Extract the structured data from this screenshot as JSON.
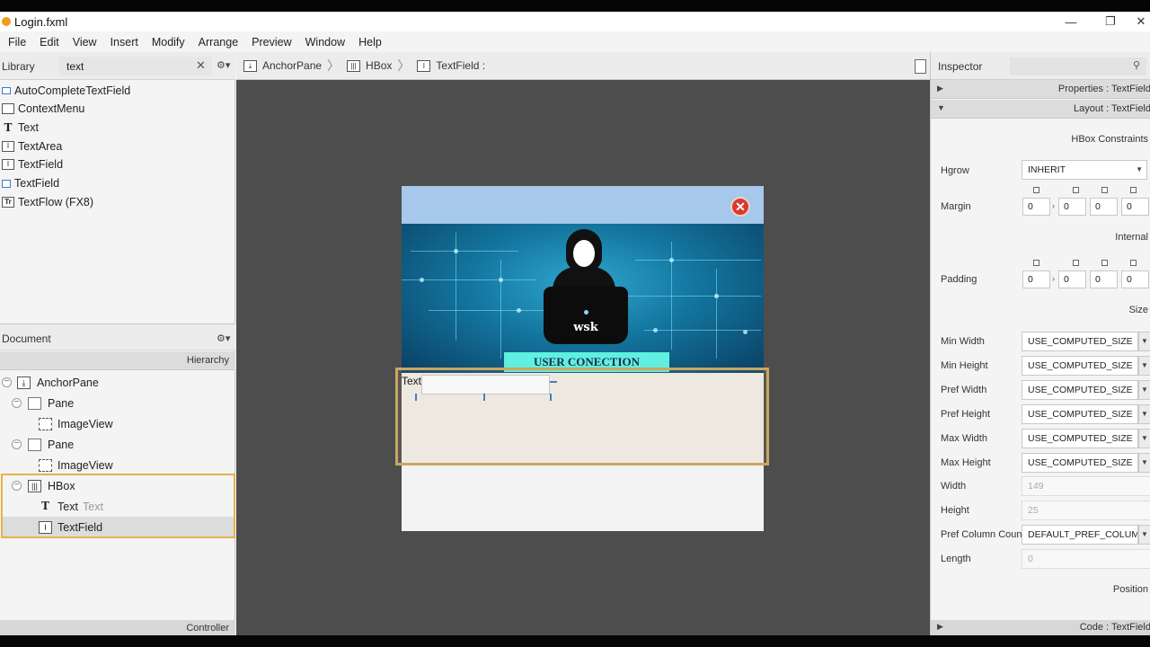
{
  "window": {
    "title": "Login.fxml",
    "minimize": "—",
    "restore": "❐",
    "close": "✕"
  },
  "menu": [
    "File",
    "Edit",
    "View",
    "Insert",
    "Modify",
    "Arrange",
    "Preview",
    "Window",
    "Help"
  ],
  "library": {
    "label": "Library",
    "search_value": "text",
    "clear_icon": "✕",
    "gear_icon": "⚙▾",
    "items": [
      {
        "label": "AutoCompleteTextField",
        "icon": "textfield-icon"
      },
      {
        "label": "ContextMenu",
        "icon": "contextmenu-icon"
      },
      {
        "label": "Text",
        "icon": "text-icon"
      },
      {
        "label": "TextArea",
        "icon": "textarea-icon"
      },
      {
        "label": "TextField",
        "icon": "textfield-icon"
      },
      {
        "label": "TextField",
        "icon": "textfield-icon"
      },
      {
        "label": "TextFlow  (FX8)",
        "icon": "textflow-icon"
      }
    ]
  },
  "document": {
    "label": "Document",
    "gear_icon": "⚙▾",
    "hierarchy_label": "Hierarchy",
    "tree": [
      {
        "label": "AnchorPane",
        "level": 0,
        "toggle": "−"
      },
      {
        "label": "Pane",
        "level": 1,
        "toggle": "−"
      },
      {
        "label": "ImageView",
        "level": 2
      },
      {
        "label": "Pane",
        "level": 1,
        "toggle": "−"
      },
      {
        "label": "ImageView",
        "level": 2
      },
      {
        "label": "HBox",
        "level": 1,
        "toggle": "−"
      },
      {
        "label": "Text",
        "sublabel": "Text",
        "level": 2
      },
      {
        "label": "TextField",
        "level": 2,
        "selected": true
      }
    ],
    "controller_label": "Controller"
  },
  "breadcrumb": [
    {
      "label": "AnchorPane"
    },
    {
      "label": "HBox"
    },
    {
      "label": "TextField :"
    }
  ],
  "form": {
    "close_icon": "✕",
    "laptop_label": "wsk",
    "banner_title": "USER CONECTION",
    "text_node": "Text"
  },
  "inspector": {
    "label": "Inspector",
    "search_icon": "🔍",
    "properties_section": "Properties : TextField",
    "layout_section": "Layout : TextField",
    "hbox_constraints": "HBox Constraints",
    "hgrow_label": "Hgrow",
    "hgrow_value": "INHERIT",
    "margin_label": "Margin",
    "margin_values": [
      "0",
      "0",
      "0",
      "0"
    ],
    "internal_label": "Internal",
    "padding_label": "Padding",
    "padding_values": [
      "0",
      "0",
      "0",
      "0"
    ],
    "size_label": "Size",
    "size_props": [
      {
        "label": "Min Width",
        "value": "USE_COMPUTED_SIZE"
      },
      {
        "label": "Min Height",
        "value": "USE_COMPUTED_SIZE"
      },
      {
        "label": "Pref Width",
        "value": "USE_COMPUTED_SIZE"
      },
      {
        "label": "Pref Height",
        "value": "USE_COMPUTED_SIZE"
      },
      {
        "label": "Max Width",
        "value": "USE_COMPUTED_SIZE"
      },
      {
        "label": "Max Height",
        "value": "USE_COMPUTED_SIZE"
      }
    ],
    "width_label": "Width",
    "width_value": "149",
    "height_label": "Height",
    "height_value": "25",
    "pref_col_label": "Pref Column Count",
    "pref_col_value": "DEFAULT_PREF_COLUMN_COUNT",
    "length_label": "Length",
    "length_value": "0",
    "position_label": "Position",
    "code_section": "Code : TextField"
  },
  "colors": {
    "accent": "#e8b04a",
    "canvas": "#4d4d4d",
    "header_blue": "#a6c8ea",
    "banner_bar": "#5ff0e0",
    "close_red": "#d73b2e"
  }
}
